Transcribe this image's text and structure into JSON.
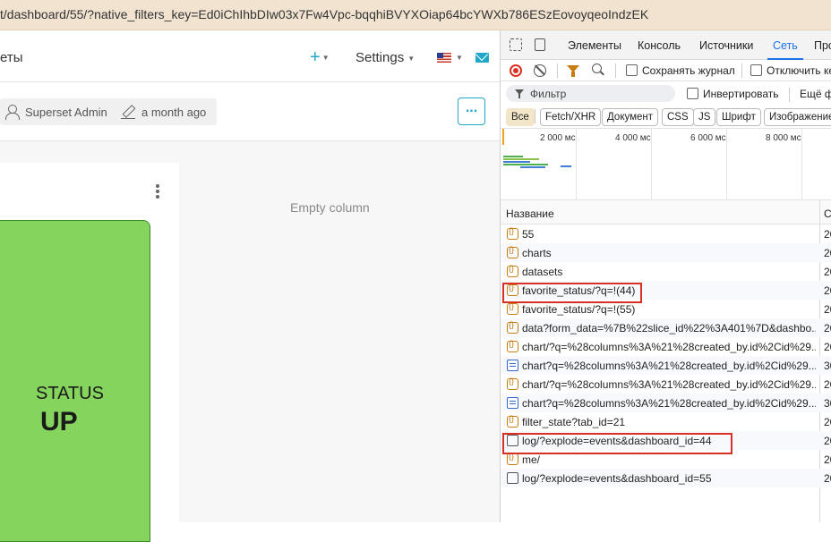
{
  "address_bar": {
    "url": "t/dashboard/55/?native_filters_key=Ed0iChIhbDIw03x7Fw4Vpc-bqqhiBVYXOiap64bcYWXb786ESzEovoyqeoIndzEK"
  },
  "app": {
    "title_partial": "еты",
    "plus_label": "+",
    "settings_label": "Settings",
    "owner": "Superset Admin",
    "modified": "a month ago",
    "more_label": "...",
    "status_tile": {
      "label": "STATUS",
      "value": "UP",
      "color": "#85d45d"
    },
    "empty_column": "Empty column"
  },
  "devtools": {
    "tabs": [
      "Элементы",
      "Консоль",
      "Источники",
      "Сеть",
      "Про"
    ],
    "active_tab": "Сеть",
    "toolbar": {
      "preserve_log": "Сохранять журнал",
      "disable_cache": "Отключить ке"
    },
    "filter": {
      "placeholder": "Фильтр",
      "invert": "Инвертировать",
      "more": "Ещё ф"
    },
    "types": [
      "Все",
      "Fetch/XHR",
      "Документ",
      "CSS",
      "JS",
      "Шрифт",
      "Изображение"
    ],
    "timeline_ticks": [
      "2 000 мс",
      "4 000 мс",
      "6 000 мс",
      "8 000 мс"
    ],
    "columns": {
      "name": "Название",
      "status": "С"
    },
    "requests": [
      {
        "name": "55",
        "status": "20",
        "icon": "xhr"
      },
      {
        "name": "charts",
        "status": "20",
        "icon": "xhr"
      },
      {
        "name": "datasets",
        "status": "20",
        "icon": "xhr"
      },
      {
        "name": "favorite_status/?q=!(44)",
        "status": "20",
        "icon": "xhr"
      },
      {
        "name": "favorite_status/?q=!(55)",
        "status": "20",
        "icon": "xhr"
      },
      {
        "name": "data?form_data=%7B%22slice_id%22%3A401%7D&dashbo...",
        "status": "20",
        "icon": "xhr"
      },
      {
        "name": "chart/?q=%28columns%3A%21%28created_by.id%2Cid%29...",
        "status": "20",
        "icon": "xhr"
      },
      {
        "name": "chart?q=%28columns%3A%21%28created_by.id%2Cid%29...",
        "status": "30",
        "icon": "doc"
      },
      {
        "name": "chart/?q=%28columns%3A%21%28created_by.id%2Cid%29...",
        "status": "20",
        "icon": "xhr"
      },
      {
        "name": "chart?q=%28columns%3A%21%28created_by.id%2Cid%29...",
        "status": "30",
        "icon": "doc"
      },
      {
        "name": "filter_state?tab_id=21",
        "status": "20",
        "icon": "xhr"
      },
      {
        "name": "log/?explode=events&dashboard_id=44",
        "status": "20",
        "icon": "other"
      },
      {
        "name": "me/",
        "status": "20",
        "icon": "xhr"
      },
      {
        "name": "log/?explode=events&dashboard_id=55",
        "status": "20",
        "icon": "other"
      }
    ]
  }
}
